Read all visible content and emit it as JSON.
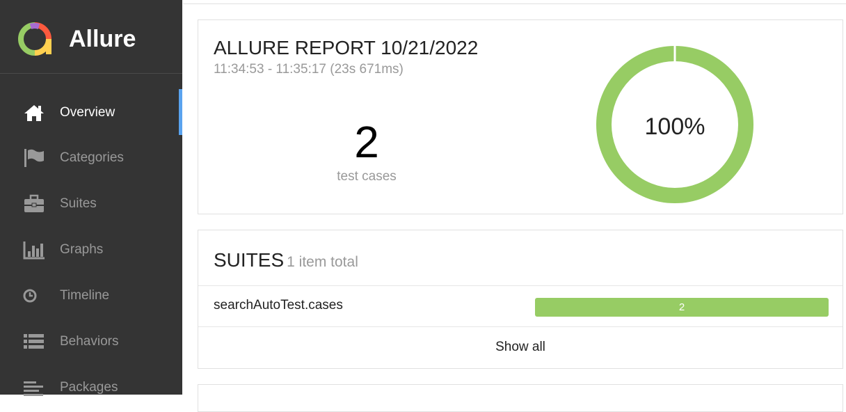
{
  "brand": {
    "name": "Allure",
    "logo_colors": [
      "#97cc64",
      "#fd5a3e",
      "#aaaaaa",
      "#ffd050"
    ]
  },
  "nav": [
    {
      "label": "Overview",
      "icon": "home-icon",
      "active": true
    },
    {
      "label": "Categories",
      "icon": "flag-icon",
      "active": false
    },
    {
      "label": "Suites",
      "icon": "briefcase-icon",
      "active": false
    },
    {
      "label": "Graphs",
      "icon": "bar-chart-icon",
      "active": false
    },
    {
      "label": "Timeline",
      "icon": "clock-icon",
      "active": false
    },
    {
      "label": "Behaviors",
      "icon": "list-icon",
      "active": false
    },
    {
      "label": "Packages",
      "icon": "align-left-icon",
      "active": false
    }
  ],
  "summary": {
    "title": "ALLURE REPORT 10/21/2022",
    "time": "11:34:53 - 11:35:17 (23s 671ms)",
    "count": "2",
    "count_label": "test cases",
    "percent": "100%",
    "passed_fraction": 1.0,
    "pass_color": "#97cc64"
  },
  "suites": {
    "title": "SUITES",
    "subtitle": "1 item total",
    "items": [
      {
        "name": "searchAutoTest.cases",
        "count": "2",
        "passed_fraction": 1.0
      }
    ],
    "show_all": "Show all"
  },
  "colors": {
    "sidebar_bg": "#343434",
    "active_indicator": "#5aa3ef"
  }
}
